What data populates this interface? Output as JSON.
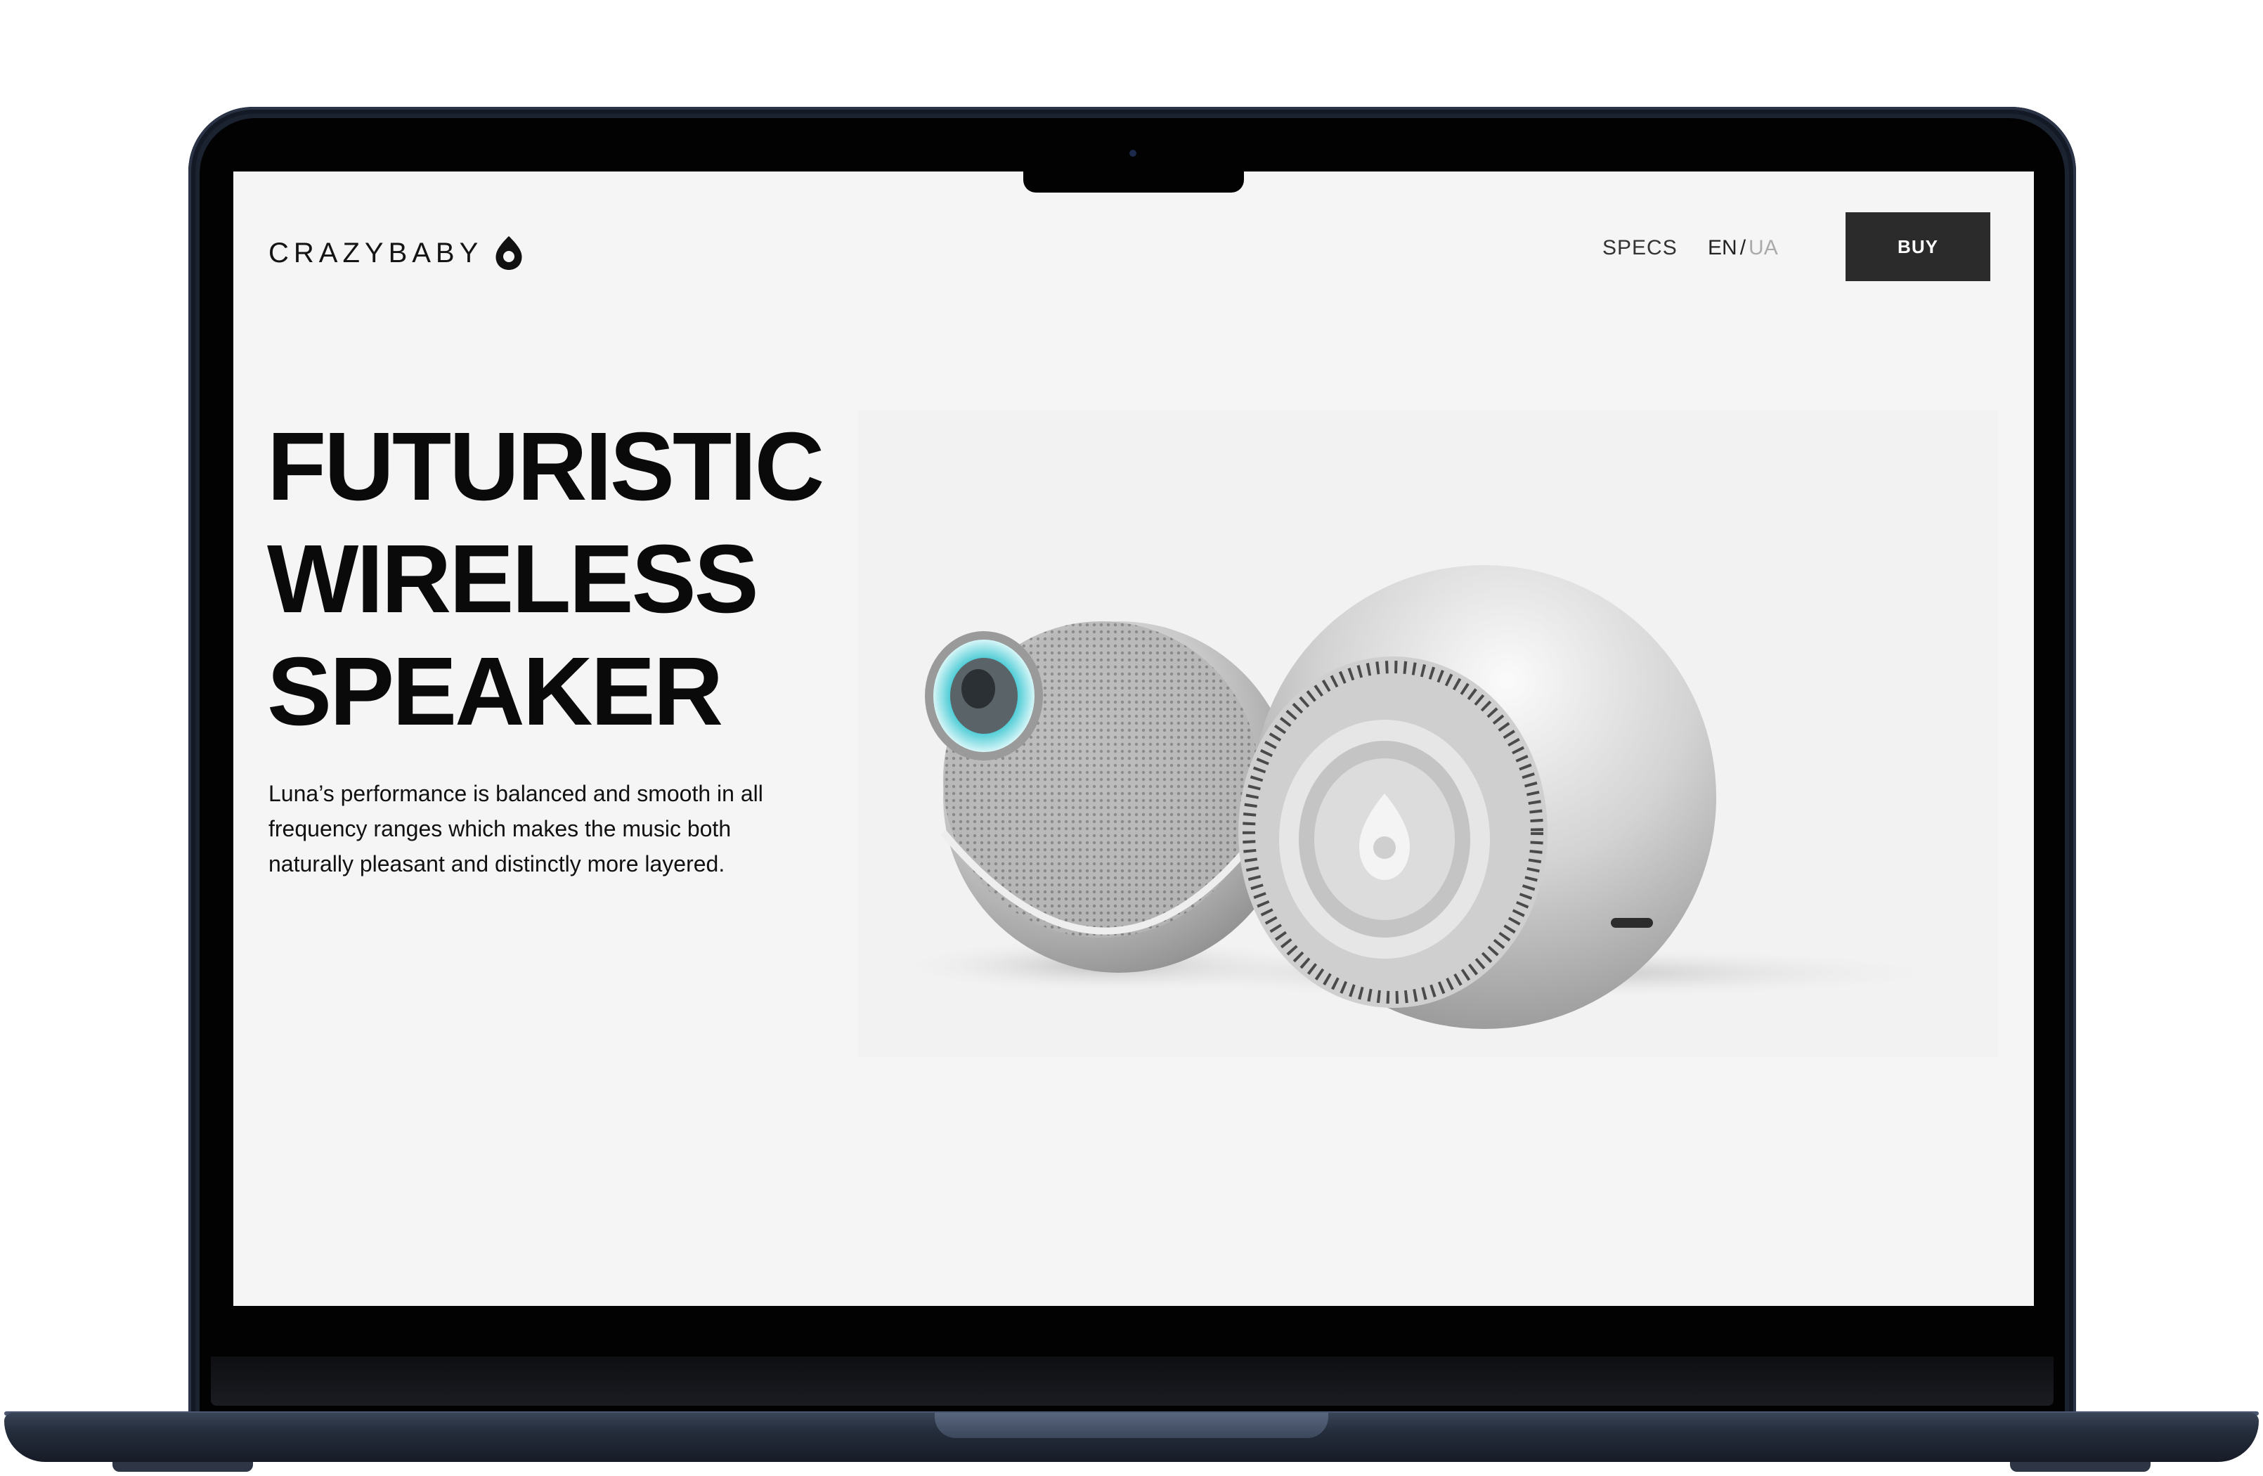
{
  "brand": {
    "name": "CRAZYBABY"
  },
  "nav": {
    "specs_label": "SPECS",
    "lang_en": "EN",
    "lang_separator": "/",
    "lang_ua": "UA",
    "buy_label": "BUY"
  },
  "hero": {
    "headline_line1": "FUTURISTIC",
    "headline_line2": "WIRELESS",
    "headline_line3": "SPEAKER",
    "description": "Luna’s performance is balanced and smooth in all frequency ranges which makes the music both naturally pleasant and distinctly more layered."
  },
  "product_image": {
    "icon": "twin-spherical-speakers"
  },
  "colors": {
    "page_background": "#f5f5f5",
    "buy_button": "#2b2b2b",
    "text": "#0a0a0a",
    "inactive_lang": "#aaaaaa",
    "speaker_accent": "#35c4cf",
    "laptop_frame": "#1b2230"
  }
}
